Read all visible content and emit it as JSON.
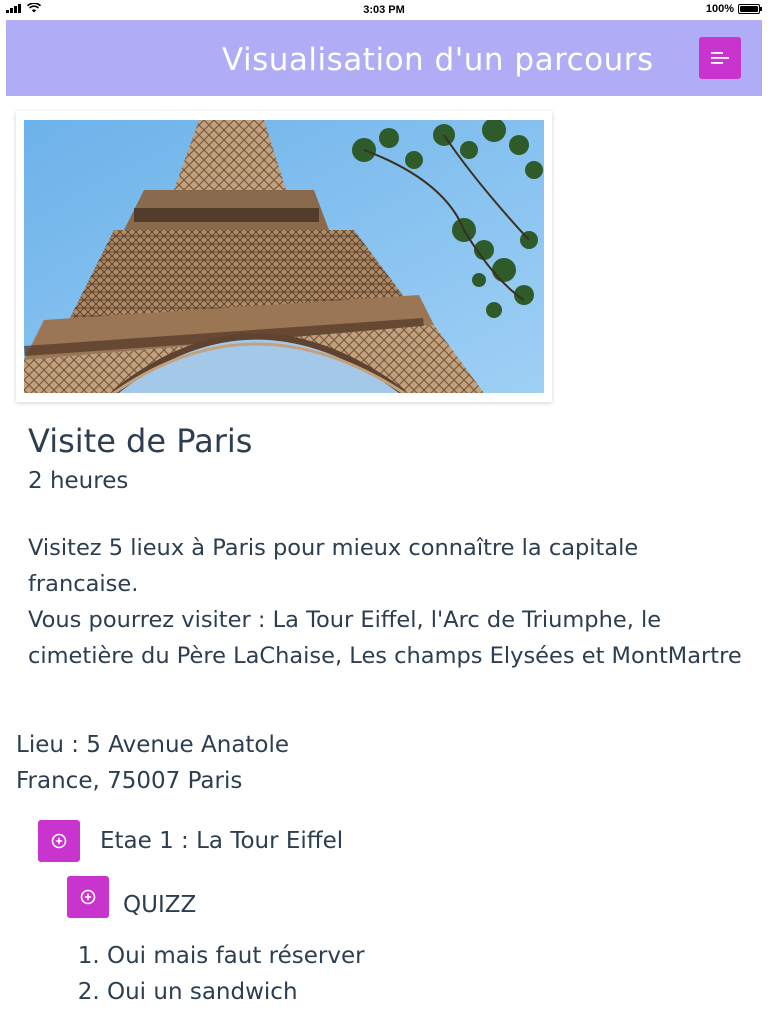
{
  "status_bar": {
    "time": "3:03 PM",
    "battery": "100%"
  },
  "header": {
    "title": "Visualisation d'un parcours",
    "menu_icon": "menu-lines-icon",
    "accent": "#c934cf",
    "background": "#b0acf6"
  },
  "tour": {
    "photo_subject": "Eiffel Tower",
    "title": "Visite de Paris",
    "duration": "2 heures",
    "description_line1": "Visitez 5 lieux à Paris pour mieux connaître la capitale francaise.",
    "description_line2": "Vous pourrez visiter : La Tour Eiffel, l'Arc de Triumphe, le cimetière du Père LaChaise, Les champs Elysées et MontMartre",
    "address_line1": "Lieu : 5 Avenue Anatole",
    "address_line2": "France, 75007 Paris"
  },
  "steps": [
    {
      "label": "Etae 1 : La Tour Eiffel",
      "quiz": {
        "label": "QUIZZ",
        "answers": [
          "Oui mais faut réserver",
          "Oui un sandwich"
        ]
      }
    }
  ]
}
